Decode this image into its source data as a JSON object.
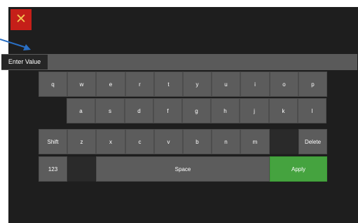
{
  "header": {
    "close_icon": "close-icon",
    "close_glyph": "✕"
  },
  "input": {
    "label": "Enter Value",
    "value": "",
    "placeholder": ""
  },
  "keyboard": {
    "row1": [
      "q",
      "w",
      "e",
      "r",
      "t",
      "y",
      "u",
      "i",
      "o",
      "p"
    ],
    "row2": [
      "a",
      "s",
      "d",
      "f",
      "g",
      "h",
      "j",
      "k",
      "l"
    ],
    "row3": [
      "z",
      "x",
      "c",
      "v",
      "b",
      "n",
      "m"
    ],
    "shift_label": "Shift",
    "delete_label": "Delete",
    "numbers_label": "123",
    "space_label": "Space",
    "apply_label": "Apply"
  },
  "colors": {
    "accent_close": "#c51f19",
    "close_icon": "#f5c451",
    "apply": "#45a33f",
    "callout_arrow": "#2a6fc4"
  }
}
